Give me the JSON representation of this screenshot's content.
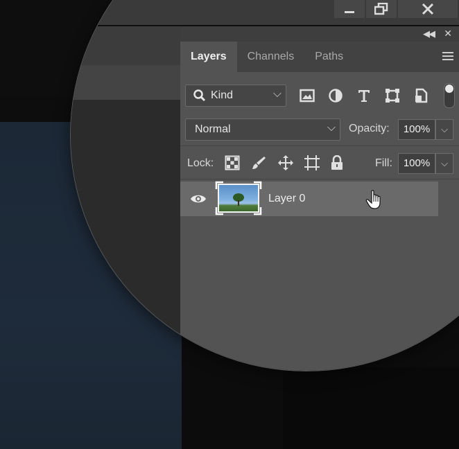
{
  "panel": {
    "tabs": [
      {
        "label": "Layers",
        "active": true
      },
      {
        "label": "Channels",
        "active": false
      },
      {
        "label": "Paths",
        "active": false
      }
    ],
    "filter": {
      "kind_label": "Kind",
      "icons": [
        "image-filter-icon",
        "adjustment-filter-icon",
        "type-filter-icon",
        "shape-filter-icon",
        "smart-object-filter-icon"
      ]
    },
    "blend_mode": "Normal",
    "opacity_label": "Opacity:",
    "opacity_value": "100%",
    "lock_label": "Lock:",
    "lock_icons": [
      "lock-transparent-pixels-icon",
      "lock-image-pixels-icon",
      "lock-position-icon",
      "lock-artboard-icon",
      "lock-all-icon"
    ],
    "fill_label": "Fill:",
    "fill_value": "100%",
    "layers": [
      {
        "name": "Layer 0",
        "visible": true,
        "selected": true
      }
    ]
  },
  "colors": {
    "panel_bg": "#535353",
    "tab_bar_bg": "#424242",
    "selected_layer_bg": "#6a6a6a"
  }
}
